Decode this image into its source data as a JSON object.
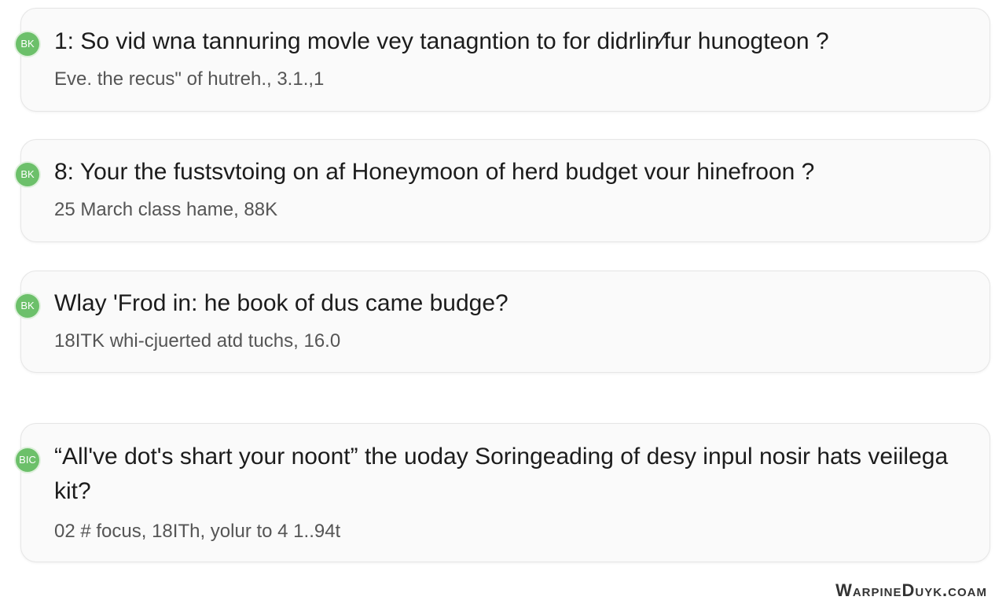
{
  "results": [
    {
      "badge": "BK",
      "title": "1: So vid wna  tannuring movle vey tanagntion to for didrlin⁄fur hunogteon ?",
      "meta": "Eve. the recus\" of hutreh., 3.1.,1"
    },
    {
      "badge": "BK",
      "title": "8: Your the fustsvtoing on af Honeymoon of herd budget  vour hinefroon ?",
      "meta": "25 March class hame, 88K"
    },
    {
      "badge": "BK",
      "title": "Wlay 'Frod in: he book of dus came budge?",
      "meta": "18ITK whi-cjuerted atd tuchs, 16.0"
    },
    {
      "badge": "BIC",
      "title": "“All've dot's shart your noont” the uoday Soringeading of desy inpul nosir hats veiilega kit?",
      "meta": "02 # focus, 18ITh, yolur to 4 1..94t"
    }
  ],
  "watermark": "WarpineDuyk.coam",
  "colors": {
    "badge": "#6cc06a",
    "card_background": "#fafafa",
    "card_border": "#e6e6e6",
    "title_text": "#1c1c1c",
    "meta_text": "#555555"
  }
}
